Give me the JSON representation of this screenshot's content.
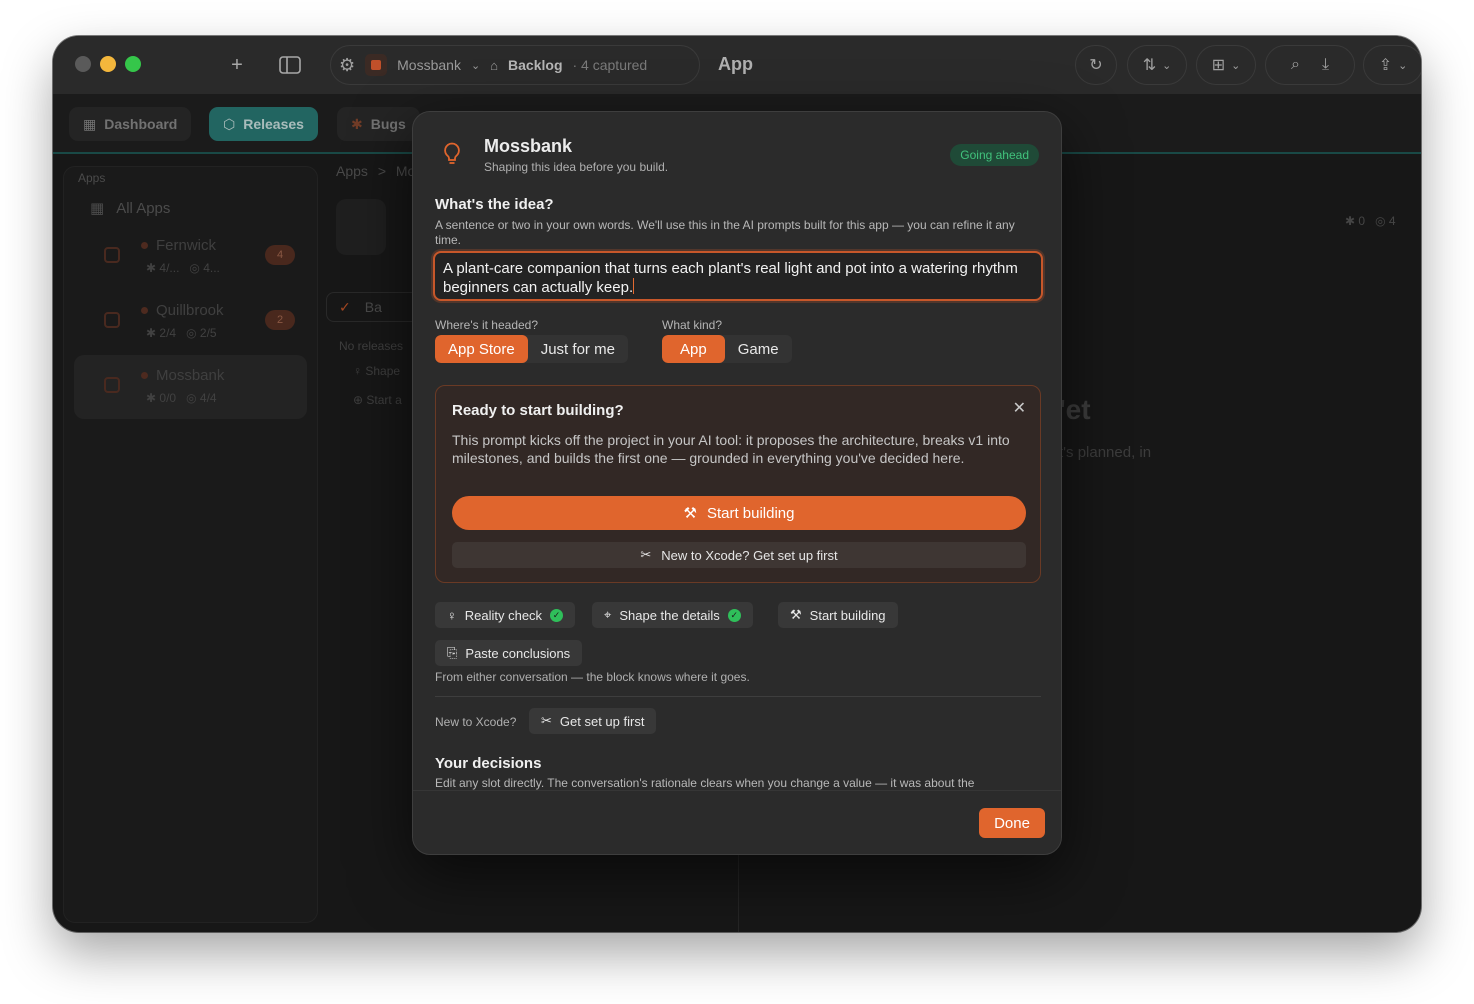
{
  "titlebar": {
    "app_name": "Mossbank",
    "backlog": "Backlog",
    "captured": "· 4 captured",
    "title": "App"
  },
  "tabs": [
    {
      "label": "Dashboard",
      "icon": "grid-icon"
    },
    {
      "label": "Releases",
      "icon": "box-icon"
    },
    {
      "label": "Bugs",
      "icon": "bug-icon"
    }
  ],
  "sidebar": {
    "heading": "Apps",
    "all_apps": "All Apps",
    "items": [
      {
        "name": "Fernwick",
        "bugs": "4/...",
        "checks": "4...",
        "badge": "4"
      },
      {
        "name": "Quillbrook",
        "bugs": "2/4",
        "checks": "2/5",
        "badge": "2"
      },
      {
        "name": "Mossbank",
        "bugs": "0/0",
        "checks": "4/4",
        "badge": ""
      }
    ]
  },
  "background": {
    "crumb_apps": "Apps",
    "crumb_sep": ">",
    "crumb_next": "Mo",
    "bar_label": "Ba",
    "no_releases": "No releases",
    "shape": "Shape",
    "start": "Start a",
    "right_stats_bugs": "0",
    "right_stats_checks": "4",
    "yet_text": "'et",
    "planned_text": "t's planned, in"
  },
  "modal": {
    "title": "Mossbank",
    "subtitle": "Shaping this idea before you build.",
    "status": "Going ahead",
    "idea_heading": "What's the idea?",
    "idea_help": "A sentence or two in your own words. We'll use this in the AI prompts built for this app — you can refine it any time.",
    "idea_value": "A plant-care companion that turns each plant's real light and pot into a watering rhythm beginners can actually keep.",
    "headed_label": "Where's it headed?",
    "headed_options": [
      "App Store",
      "Just for me"
    ],
    "kind_label": "What kind?",
    "kind_options": [
      "App",
      "Game"
    ],
    "ready": {
      "heading": "Ready to start building?",
      "body": "This prompt kicks off the project in your AI tool: it proposes the architecture, breaks v1 into milestones, and builds the first one — grounded in everything you've decided here.",
      "start_label": "Start building",
      "xcode_label": "New to Xcode? Get set up first"
    },
    "steps": [
      {
        "label": "Reality check",
        "done": true
      },
      {
        "label": "Shape the details",
        "done": true
      },
      {
        "label": "Start building",
        "done": false
      }
    ],
    "paste_label": "Paste conclusions",
    "paste_help": "From either conversation — the block knows where it goes.",
    "new_xcode_label": "New to Xcode?",
    "get_set_up": "Get set up first",
    "decisions_heading": "Your decisions",
    "decisions_help": "Edit any slot directly. The conversation's rationale clears when you change a value — it was about the",
    "done_label": "Done"
  },
  "colors": {
    "accent": "#e0652d",
    "teal": "#2a7c77",
    "success": "#2fbf5a"
  }
}
